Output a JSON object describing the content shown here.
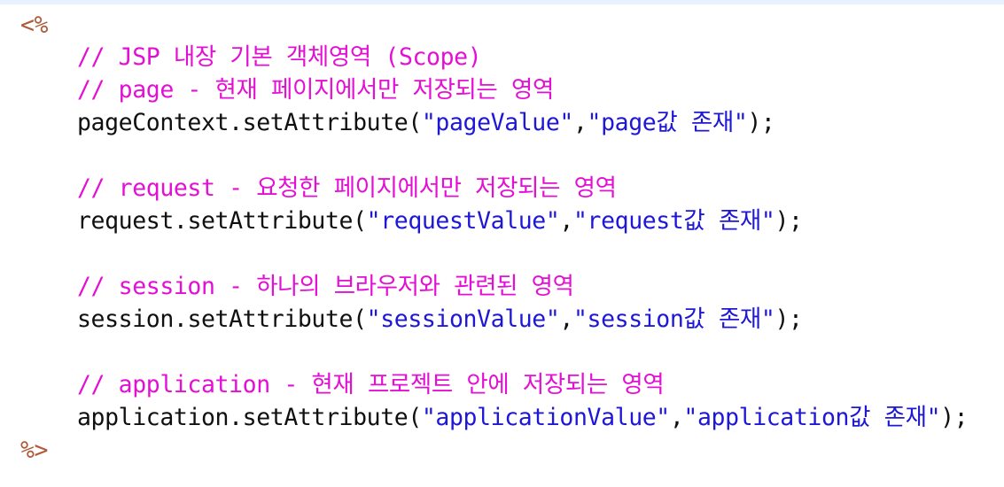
{
  "editor": {
    "open_tag": "<%",
    "close_tag": "%>",
    "lines": [
      {
        "comment": "// JSP 내장 기본 객체영역 (Scope)"
      },
      {
        "comment": "// page - 현재 페이지에서만 저장되는 영역"
      },
      {
        "obj": "pageContext",
        "call": ".setAttribute(",
        "key": "\"pageValue\"",
        "sep": ",",
        "val": "\"page값 존재\"",
        "end": ");"
      },
      {
        "comment": "// request - 요청한 페이지에서만 저장되는 영역"
      },
      {
        "obj": "request",
        "call": ".setAttribute(",
        "key": "\"requestValue\"",
        "sep": ",",
        "val": "\"request값 존재\"",
        "end": ");"
      },
      {
        "comment": "// session - 하나의 브라우저와 관련된 영역"
      },
      {
        "obj": "session",
        "call": ".setAttribute(",
        "key": "\"sessionValue\"",
        "sep": ",",
        "val": "\"session값 존재\"",
        "end": ");"
      },
      {
        "comment": "// application - 현재 프로젝트 안에 저장되는 영역"
      },
      {
        "obj": "application",
        "call": ".setAttribute(",
        "key": "\"applicationValue\"",
        "sep": ",",
        "val": "\"application값 존재\"",
        "end": ");"
      }
    ]
  },
  "colors": {
    "tag": "#b05a3c",
    "comment": "#e40fd4",
    "code": "#101010",
    "string": "#1f17d6",
    "top_bar": "#e8f2fe"
  }
}
